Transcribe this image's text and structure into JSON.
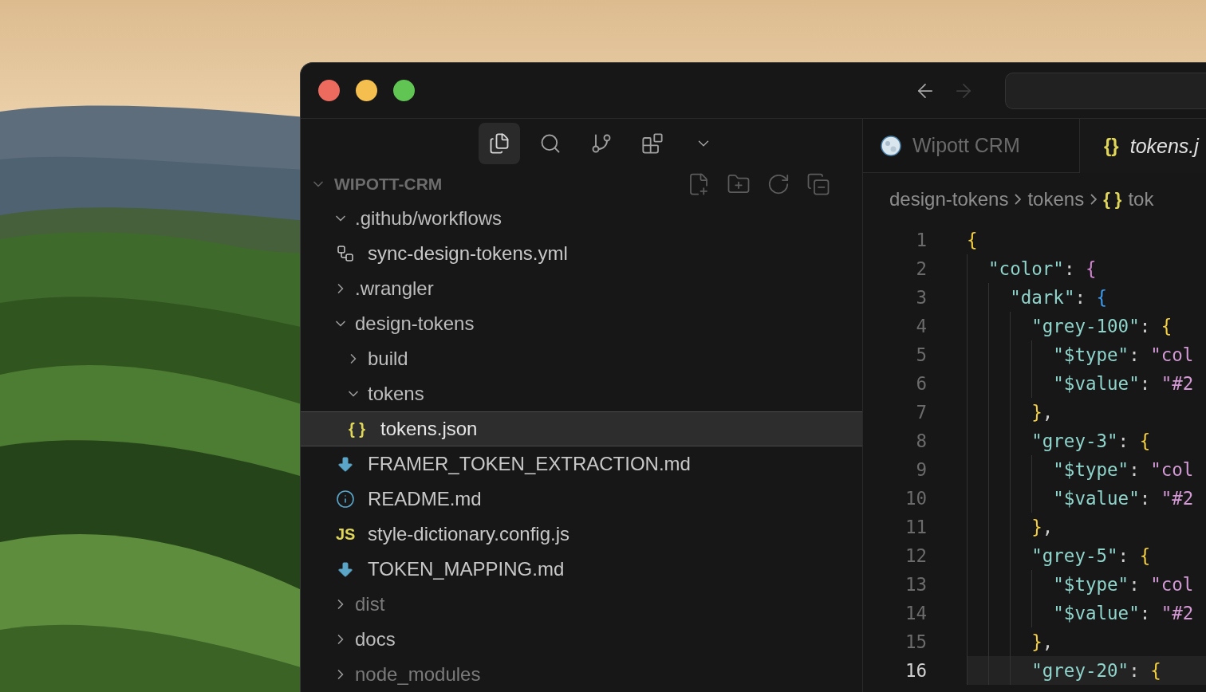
{
  "title_bar": {
    "nav": [
      {
        "kind": "back",
        "disabled": false
      },
      {
        "kind": "forward",
        "disabled": true
      }
    ]
  },
  "activity_bar": [
    {
      "kind": "explorer",
      "selected": true
    },
    {
      "kind": "search",
      "selected": false
    },
    {
      "kind": "source-control",
      "selected": false
    },
    {
      "kind": "extensions",
      "selected": false
    },
    {
      "kind": "more",
      "selected": false
    }
  ],
  "explorer": {
    "title": "WIPOTT-CRM",
    "expanded": true,
    "actions": [
      {
        "kind": "new-file"
      },
      {
        "kind": "new-folder"
      },
      {
        "kind": "refresh"
      },
      {
        "kind": "collapse"
      }
    ],
    "tree": [
      {
        "label": ".github/workflows",
        "kind": "folder",
        "expanded": true,
        "selected": false,
        "dimmed": false,
        "children": [
          {
            "label": "sync-design-tokens.yml",
            "kind": "workflow",
            "selected": false,
            "dimmed": false
          }
        ]
      },
      {
        "label": ".wrangler",
        "kind": "folder",
        "expanded": false,
        "selected": false,
        "dimmed": false
      },
      {
        "label": "design-tokens",
        "kind": "folder",
        "expanded": true,
        "selected": false,
        "dimmed": false,
        "children": [
          {
            "label": "build",
            "kind": "folder",
            "expanded": false,
            "selected": false,
            "dimmed": false
          },
          {
            "label": "tokens",
            "kind": "folder",
            "expanded": true,
            "selected": false,
            "dimmed": false,
            "children": [
              {
                "label": "tokens.json",
                "kind": "json",
                "glyph": "{ }",
                "selected": true,
                "dimmed": false
              }
            ]
          },
          {
            "label": "FRAMER_TOKEN_EXTRACTION.md",
            "kind": "markdown",
            "selected": false,
            "dimmed": false
          },
          {
            "label": "README.md",
            "kind": "info",
            "selected": false,
            "dimmed": false
          },
          {
            "label": "style-dictionary.config.js",
            "kind": "js",
            "glyph": "JS",
            "selected": false,
            "dimmed": false
          },
          {
            "label": "TOKEN_MAPPING.md",
            "kind": "markdown",
            "selected": false,
            "dimmed": false
          }
        ]
      },
      {
        "label": "dist",
        "kind": "folder",
        "expanded": false,
        "selected": false,
        "dimmed": true
      },
      {
        "label": "docs",
        "kind": "folder",
        "expanded": false,
        "selected": false,
        "dimmed": false
      },
      {
        "label": "node_modules",
        "kind": "folder",
        "expanded": false,
        "selected": false,
        "dimmed": true
      }
    ]
  },
  "tabs": [
    {
      "label": "Wipott CRM",
      "kind": "web",
      "selected": false,
      "preview": false
    },
    {
      "label": "tokens.j",
      "kind": "json",
      "glyph": "{}",
      "selected": true,
      "preview": true
    }
  ],
  "breadcrumb": [
    {
      "label": "design-tokens"
    },
    {
      "label": "tokens"
    },
    {
      "label": "tok",
      "glyph": "{ }"
    }
  ],
  "editor": {
    "lines": [
      {
        "number": "1",
        "current": false,
        "segments": [
          {
            "kind": "brace-1",
            "text": "{"
          }
        ]
      },
      {
        "number": "2",
        "current": false,
        "segments": [
          {
            "kind": "key",
            "text": "  \"color\""
          },
          {
            "kind": "punct",
            "text": ": "
          },
          {
            "kind": "brace-2",
            "text": "{"
          }
        ]
      },
      {
        "number": "3",
        "current": false,
        "segments": [
          {
            "kind": "key",
            "text": "    \"dark\""
          },
          {
            "kind": "punct",
            "text": ": "
          },
          {
            "kind": "brace-3",
            "text": "{"
          }
        ]
      },
      {
        "number": "4",
        "current": false,
        "segments": [
          {
            "kind": "key",
            "text": "      \"grey-100\""
          },
          {
            "kind": "punct",
            "text": ": "
          },
          {
            "kind": "brace-1",
            "text": "{"
          }
        ]
      },
      {
        "number": "5",
        "current": false,
        "segments": [
          {
            "kind": "key",
            "text": "        \"$type\""
          },
          {
            "kind": "punct",
            "text": ": "
          },
          {
            "kind": "string",
            "text": "\"col"
          }
        ]
      },
      {
        "number": "6",
        "current": false,
        "segments": [
          {
            "kind": "key",
            "text": "        \"$value\""
          },
          {
            "kind": "punct",
            "text": ": "
          },
          {
            "kind": "string",
            "text": "\"#2"
          }
        ]
      },
      {
        "number": "7",
        "current": false,
        "segments": [
          {
            "kind": "brace-1",
            "text": "      }"
          },
          {
            "kind": "punct",
            "text": ","
          }
        ]
      },
      {
        "number": "8",
        "current": false,
        "segments": [
          {
            "kind": "key",
            "text": "      \"grey-3\""
          },
          {
            "kind": "punct",
            "text": ": "
          },
          {
            "kind": "brace-1",
            "text": "{"
          }
        ]
      },
      {
        "number": "9",
        "current": false,
        "segments": [
          {
            "kind": "key",
            "text": "        \"$type\""
          },
          {
            "kind": "punct",
            "text": ": "
          },
          {
            "kind": "string",
            "text": "\"col"
          }
        ]
      },
      {
        "number": "10",
        "current": false,
        "segments": [
          {
            "kind": "key",
            "text": "        \"$value\""
          },
          {
            "kind": "punct",
            "text": ": "
          },
          {
            "kind": "string",
            "text": "\"#2"
          }
        ]
      },
      {
        "number": "11",
        "current": false,
        "segments": [
          {
            "kind": "brace-1",
            "text": "      }"
          },
          {
            "kind": "punct",
            "text": ","
          }
        ]
      },
      {
        "number": "12",
        "current": false,
        "segments": [
          {
            "kind": "key",
            "text": "      \"grey-5\""
          },
          {
            "kind": "punct",
            "text": ": "
          },
          {
            "kind": "brace-1",
            "text": "{"
          }
        ]
      },
      {
        "number": "13",
        "current": false,
        "segments": [
          {
            "kind": "key",
            "text": "        \"$type\""
          },
          {
            "kind": "punct",
            "text": ": "
          },
          {
            "kind": "string",
            "text": "\"col"
          }
        ]
      },
      {
        "number": "14",
        "current": false,
        "segments": [
          {
            "kind": "key",
            "text": "        \"$value\""
          },
          {
            "kind": "punct",
            "text": ": "
          },
          {
            "kind": "string",
            "text": "\"#2"
          }
        ]
      },
      {
        "number": "15",
        "current": false,
        "segments": [
          {
            "kind": "brace-1",
            "text": "      }"
          },
          {
            "kind": "punct",
            "text": ","
          }
        ]
      },
      {
        "number": "16",
        "current": true,
        "segments": [
          {
            "kind": "key",
            "text": "      \"grey-20\""
          },
          {
            "kind": "punct",
            "text": ": "
          },
          {
            "kind": "brace-1",
            "text": "{"
          }
        ]
      }
    ]
  }
}
